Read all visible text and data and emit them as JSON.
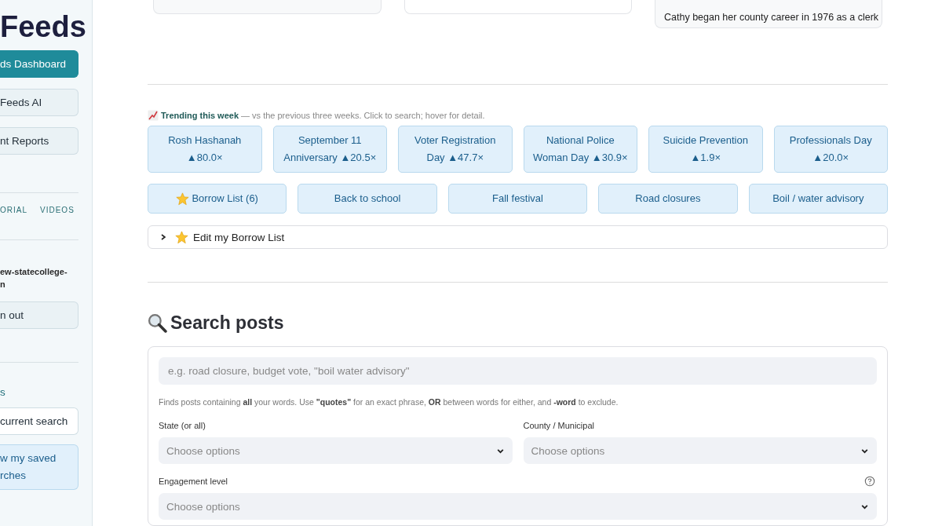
{
  "sidebar": {
    "logo": "Feeds",
    "nav": [
      {
        "label": "ds Dashboard",
        "selected": true
      },
      {
        "label": "Feeds AI",
        "selected": false
      },
      {
        "label": "nt Reports",
        "selected": false
      }
    ],
    "tabs": [
      "ORIAL",
      "VIDEOS"
    ],
    "account_lines": [
      "ew-statecollege-",
      "n"
    ],
    "sign_out": "n out",
    "saved_heading": "s",
    "save_button": "current search",
    "view_saved_lines": [
      "w my saved",
      "rches"
    ]
  },
  "top_cards": [
    {
      "kind": "blank"
    },
    {
      "kind": "blank"
    },
    {
      "kind": "text",
      "text": "Cathy began her county career in 1976 as a clerk"
    }
  ],
  "trending": {
    "title": "Trending this week",
    "note": "— vs the previous three weeks. Click to search; hover for detail.",
    "chips": [
      {
        "lines": [
          "Rosh Hashanah",
          "▲80.0×"
        ]
      },
      {
        "lines": [
          "September 11",
          "Anniversary ▲20.5×"
        ]
      },
      {
        "lines": [
          "Voter Registration",
          "Day ▲47.7×"
        ]
      },
      {
        "lines": [
          "National Police",
          "Woman Day ▲30.9×"
        ]
      },
      {
        "lines": [
          "Suicide Prevention",
          "▲1.9×"
        ]
      },
      {
        "lines": [
          "Professionals Day",
          "▲20.0×"
        ]
      }
    ]
  },
  "quick_searches": [
    {
      "kind": "starred",
      "label": "Borrow List (6)"
    },
    {
      "kind": "plain",
      "label": "Back to school"
    },
    {
      "kind": "plain",
      "label": "Fall festival"
    },
    {
      "kind": "plain",
      "label": "Road closures"
    },
    {
      "kind": "plain",
      "label": "Boil / water advisory"
    }
  ],
  "borrow_expander": {
    "label": "Edit my Borrow List",
    "expanded": false
  },
  "search": {
    "heading": "Search posts",
    "query": {
      "placeholder": "e.g. road closure, budget vote, \"boil water advisory\""
    },
    "hint": "Finds posts containing **all** your words. Use **\"quotes\"** for an exact phrase, **OR** between words for either, and **-word** to exclude.",
    "filters": [
      {
        "label": "State (or all)",
        "placeholder": "Choose options",
        "help": false
      },
      {
        "label": "County / Municipal",
        "placeholder": "Choose options",
        "help": false
      },
      {
        "label": "Engagement level",
        "placeholder": "Choose options",
        "help": true
      }
    ]
  }
}
